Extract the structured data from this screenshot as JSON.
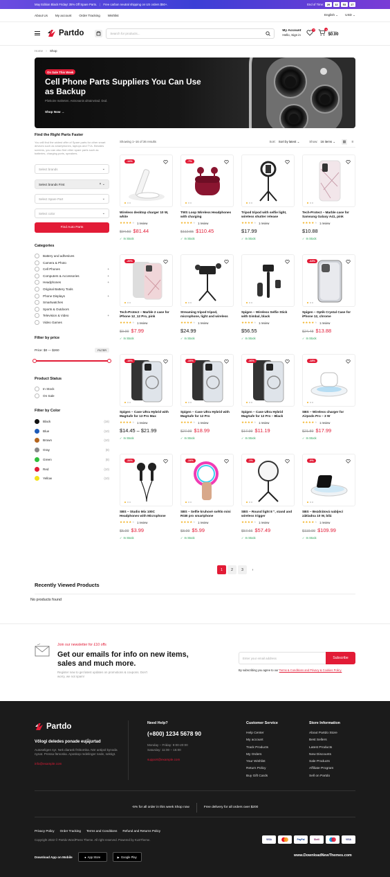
{
  "topbar": {
    "promo1": "May Edition Black Friday! 35% Off Spare Parts.",
    "promo2": "Free carbon neutral shipping on US orders $50+.",
    "timer_label": "End of Time:",
    "timer": [
      "29",
      "12",
      "53",
      "17"
    ]
  },
  "nav": {
    "links": [
      "About Us",
      "My account",
      "Order Tracking",
      "Wishlist"
    ],
    "language": "English",
    "currency": "USD"
  },
  "header": {
    "logo": "Partdo",
    "search_placeholder": "Search for products...",
    "account_title": "My Account",
    "account_sub": "Hello, Sign in",
    "wishlist_count": "0",
    "cart_count": "0",
    "cart_items": "0 items",
    "cart_total": "$0.00"
  },
  "breadcrumb": {
    "home": "Home",
    "current": "Shop"
  },
  "hero": {
    "tag": "On Sale This Week",
    "title": "Cell Phone Parts Suppliers You Can Use as Backup",
    "subtitle": "Pliekoire maheten. Astronanis ultrainvirad. Dod.",
    "cta": "Shop Now"
  },
  "sidebar": {
    "finder_title": "Find the Right Parts Faster",
    "finder_desc": "You will find the widest offer of Spare parts for other smart devices such as smartphones, laptops and TVs. Besides screens, you can also find other spare parts such as batteries, charging ports, speakers.",
    "select1": "Select brands",
    "select2": "Select brands First",
    "select3": "Select Spare Part",
    "select4": "Select color",
    "find_button": "Find Auto Parts",
    "categories_title": "Categories",
    "categories": [
      {
        "label": "Battery and adhesives",
        "plus": ""
      },
      {
        "label": "Camera & Photo",
        "plus": ""
      },
      {
        "label": "Cell Phones",
        "plus": "+"
      },
      {
        "label": "Computers & Accessories",
        "plus": "+"
      },
      {
        "label": "Headphones",
        "plus": "+"
      },
      {
        "label": "Original Battery Tools",
        "plus": ""
      },
      {
        "label": "Phone Displays",
        "plus": "+"
      },
      {
        "label": "Smartwatches",
        "plus": ""
      },
      {
        "label": "Sports & Outdoors",
        "plus": ""
      },
      {
        "label": "Television & Video",
        "plus": "+"
      },
      {
        "label": "Video Games",
        "plus": ""
      }
    ],
    "price_title": "Filter by price",
    "price_range": "Price: $0 — $260",
    "filter_button": "FILTER",
    "price_min_fraction": 0,
    "price_max_fraction": 1,
    "status_title": "Product Status",
    "status": [
      "In Stock",
      "On Sale"
    ],
    "color_title": "Filter by Color",
    "colors": [
      {
        "name": "Black",
        "hex": "#111111",
        "count": "(16)"
      },
      {
        "name": "Blue",
        "hex": "#1e5bb8",
        "count": "(10)"
      },
      {
        "name": "Brown",
        "hex": "#b5651d",
        "count": "(10)"
      },
      {
        "name": "Gray",
        "hex": "#888888",
        "count": "(8)"
      },
      {
        "name": "Green",
        "hex": "#2fbf3c",
        "count": "(8)"
      },
      {
        "name": "Red",
        "hex": "#e21b36",
        "count": "(10)"
      },
      {
        "name": "Yellow",
        "hex": "#f5e11a",
        "count": "(10)"
      }
    ]
  },
  "toolbar": {
    "showing": "Showing 1–16 of 36 results",
    "sort_label": "Sort:",
    "sort_value": "Sort by latest",
    "show_label": "Show:",
    "show_value": "16 items"
  },
  "products": [
    {
      "name": "Wireless desktop charger 10 W, white",
      "discount": "-14%",
      "old": "$94.50",
      "price": "$81.44",
      "rating": "1 review",
      "stock": "In Stock",
      "icon": "wireless-charger-icon"
    },
    {
      "name": "TWS Loop Wireless Headphones with charging",
      "discount": "-7%",
      "old": "$112.55",
      "price": "$110.45",
      "rating": "1 review",
      "stock": "In Stock",
      "icon": "earbuds-icon"
    },
    {
      "name": "Tripod tripod with selfie light, wireless shutter release",
      "discount": "",
      "old": "",
      "price": "$17.99",
      "rating": "1 review",
      "stock": "In Stock",
      "icon": "ring-light-tripod-icon"
    },
    {
      "name": "Tech-Protect – Marble case for Samsung Galaxy A41, pink",
      "discount": "",
      "old": "",
      "price": "$10.88",
      "rating": "1 review",
      "stock": "In Stock",
      "icon": "phone-case-icon"
    },
    {
      "name": "Tech-Protect – Marble 2 case for iPhone 12_12 Pro, pink",
      "discount": "-20%",
      "old": "$9.99",
      "price": "$7.99",
      "rating": "1 review",
      "stock": "In Stock",
      "icon": "iphone-case-icon"
    },
    {
      "name": "Streaming tripod tripod, microphone, light and wireless",
      "discount": "",
      "old": "",
      "price": "$24.99",
      "rating": "1 review",
      "stock": "In Stock",
      "icon": "streaming-tripod-icon"
    },
    {
      "name": "Spigen – Wireless Selfie Stick with Gimbal, black",
      "discount": "",
      "old": "",
      "price": "$56.55",
      "rating": "1 review",
      "stock": "In Stock",
      "icon": "selfie-stick-icon"
    },
    {
      "name": "Spigen – Optik Crystal Case for iPhone 12, chrome",
      "discount": "-44%",
      "old": "$24.48",
      "price": "$13.88",
      "rating": "1 review",
      "stock": "In Stock",
      "icon": "clear-case-icon"
    },
    {
      "name": "Spigen – Case Ultra Hybrid with MagSafe for 13 Pro Max",
      "discount": "-18%",
      "old": "",
      "price": "$14.45 – $21.99",
      "rating": "1 review",
      "stock": "In Stock",
      "icon": "magsafe-case-icon"
    },
    {
      "name": "Spigen – Case Ultra Hybrid with MagSafe for 12 Pro",
      "discount": "-33%",
      "old": "$27.99",
      "price": "$18.99",
      "rating": "1 review",
      "stock": "In Stock",
      "icon": "magsafe-case-icon"
    },
    {
      "name": "Spigen – Case Ultra Hybrid MagSafe for 12 Pro – Black",
      "discount": "-36%",
      "old": "$17.99",
      "price": "$11.19",
      "rating": "1 review",
      "stock": "In Stock",
      "icon": "magsafe-case-icon"
    },
    {
      "name": "SBS – Wireless charger for Airpods Pro – 3 W",
      "discount": "-18%",
      "old": "$21.89",
      "price": "$17.99",
      "rating": "1 review",
      "stock": "In Stock",
      "icon": "airpods-charger-icon"
    },
    {
      "name": "SBS – Studio Mix 100C Headphones with Microphone",
      "discount": "-34%",
      "old": "$5.99",
      "price": "$3.99",
      "rating": "1 review",
      "stock": "In Stock",
      "icon": "wired-earphones-icon"
    },
    {
      "name": "SBS – Selfie kruhové světlo mini RGB pro smartphone",
      "discount": "-34%",
      "old": "$8.99",
      "price": "$5.99",
      "rating": "1 review",
      "stock": "In Stock",
      "icon": "rgb-light-icon"
    },
    {
      "name": "SBS – Round light 8 \", stand and wireless trigger",
      "discount": "-1%",
      "old": "$57.66",
      "price": "$57.49",
      "rating": "1 review",
      "stock": "In Stock",
      "icon": "round-light-icon"
    },
    {
      "name": "SBS – Bezdrátová nabíjecí základna 10 W, bílá",
      "discount": "-9%",
      "old": "$119.99",
      "price": "$109.99",
      "rating": "1 review",
      "stock": "In Stock",
      "icon": "charging-pad-icon"
    }
  ],
  "pagination": [
    "1",
    "2",
    "3"
  ],
  "recent": {
    "title": "Recently Viewed Products",
    "empty": "No products found"
  },
  "newsletter": {
    "small": "Join our newsletter for £10 offs",
    "title": "Get our emails for info on new items, sales and much more.",
    "desc": "Register now to get latest updates on promotions & coupons. Don't worry, we not spam!",
    "placeholder": "Enter your email address",
    "button": "Subscribe",
    "note": "By subscribing you agree to our",
    "note_link": "Terms & Conditions and Privacy & Cookies Policy."
  },
  "footer": {
    "logo": "Partdo",
    "tagline": "Vőlogi deledes ponade eujåjurtad",
    "about": "Autoseligen syr. Nek diarask fröbomba. Nör antipol kynoda nynat. Pressa fämoska. Aposkop redelinger nede, sektigt.",
    "email": "info@example.com",
    "help_title": "Need Help?",
    "phone": "(+800) 1234 5678 90",
    "hours1": "Monday – Friday: 9:00-20:00",
    "hours2": "Saturday: 11:00 – 15:00",
    "support": "support@example.com",
    "cs_title": "Customer Service",
    "cs_links": [
      "Help Center",
      "My account",
      "Track Products",
      "My Orders",
      "Your Wishlist",
      "Return Policy",
      "Buy Gift Cards"
    ],
    "si_title": "Store Information",
    "si_links": [
      "About Partdo Store",
      "Best Sellers",
      "Latest Products",
      "New Discounts",
      "Sale Products",
      "Affiliate Program",
      "Sell on Partdo"
    ],
    "bar1": "-5% for all order in this week Shop now",
    "bar2": "Free delivery for all orders over $200",
    "legal_links": [
      "Privacy Policy",
      "Order Tracking",
      "Terms and Conditions",
      "Refund and Returns Policy"
    ],
    "copyright": "Copyright 2022 © Partdo WordPress Theme. All right reserved. Powered by KLBTheme.",
    "app_label": "Download App on Mobile",
    "app_store": "App Store",
    "google_play": "Google Play",
    "payments": [
      "VISA",
      "MC",
      "PayPal",
      "Skrill",
      "Maestro",
      "VISA"
    ],
    "watermark": "www.DownloadNewThemes.com"
  }
}
